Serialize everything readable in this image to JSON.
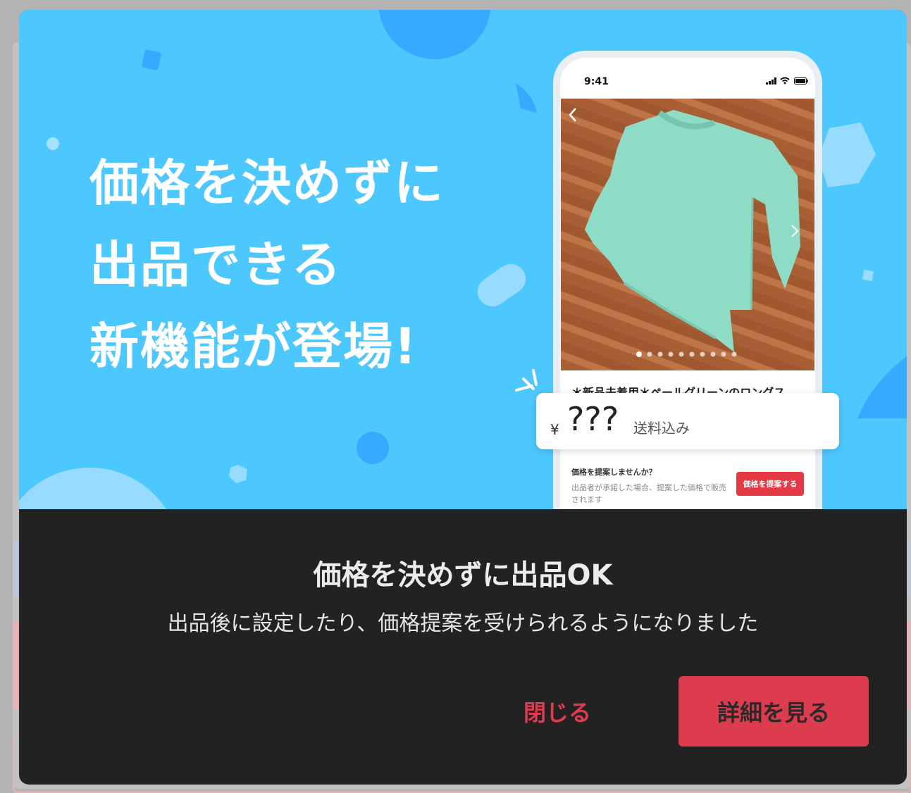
{
  "hero": {
    "headline": "価格を決めずに\n出品できる\n新機能が登場!",
    "background_color": "#4dc8ff"
  },
  "phone": {
    "status_time": "9:41",
    "status_icons": [
      "signal-icon",
      "wifi-icon",
      "battery-icon"
    ],
    "item_title": "＊新品未着用＊ペールグリーンのロングス",
    "photo_page_indicator": {
      "count": 10,
      "active": 1
    },
    "price": {
      "currency": "¥",
      "amount": "???",
      "shipping": "送料込み"
    },
    "offer": {
      "title": "価格を提案しませんか？",
      "description": "出品者が承諾した場合、提案した価格で販売されます",
      "button_label": "価格を提案する"
    }
  },
  "dialog": {
    "title": "価格を決めずに出品OK",
    "description": "出品後に設定したり、価格提案を受けられるようになりました",
    "close_label": "閉じる",
    "detail_label": "詳細を見る",
    "accent_color": "#dc3c4e"
  }
}
